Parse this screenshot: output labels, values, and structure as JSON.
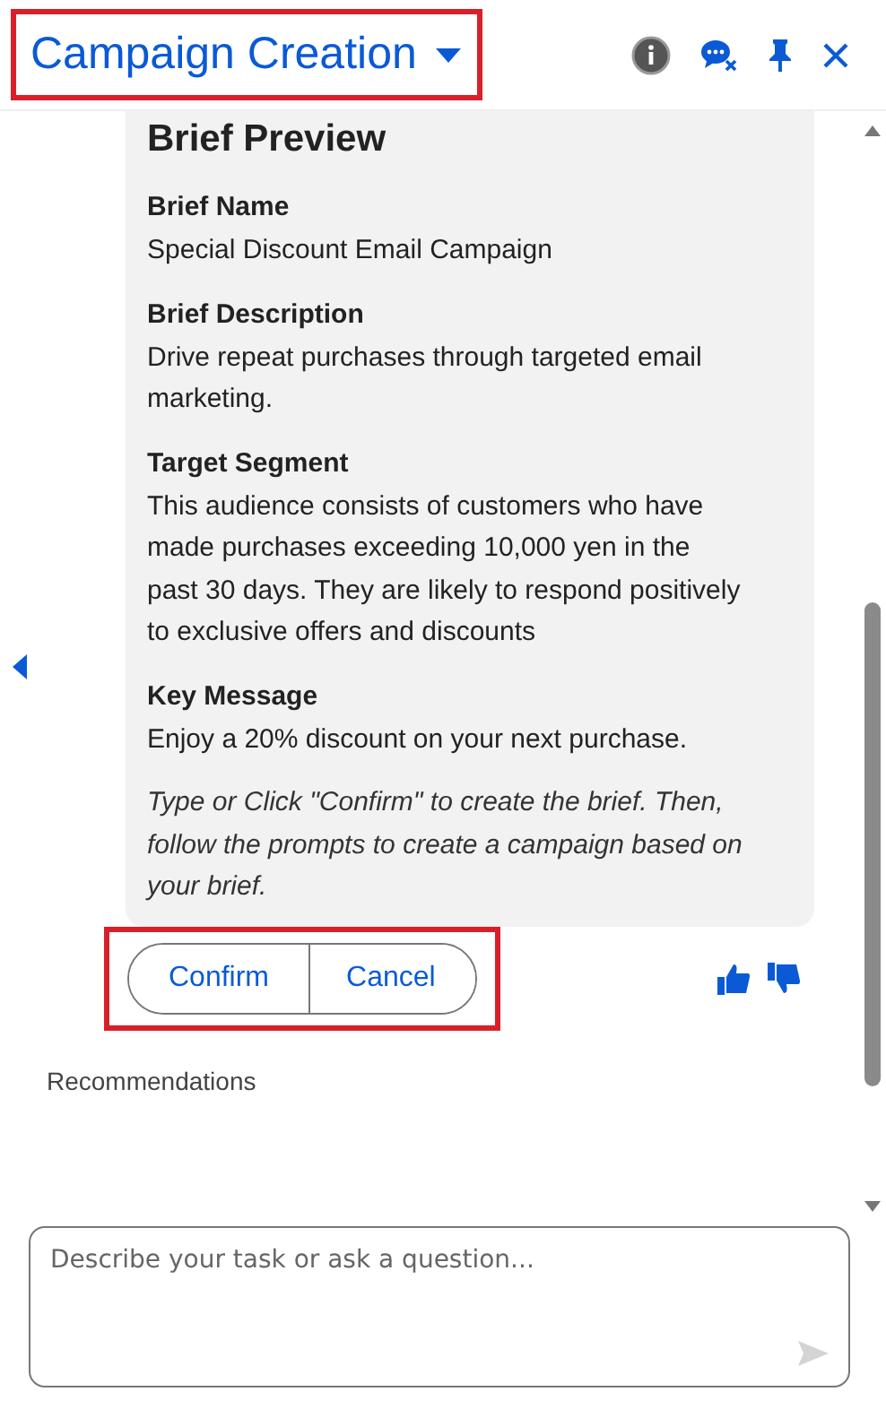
{
  "header": {
    "title": "Campaign Creation",
    "highlighted": true
  },
  "card": {
    "title": "Brief Preview",
    "sections": [
      {
        "label": "Brief Name",
        "value": "Special Discount Email Campaign"
      },
      {
        "label": "Brief Description",
        "value": "Drive repeat purchases through targeted email marketing."
      },
      {
        "label": "Target Segment",
        "value": "This audience consists of customers who have made purchases exceeding 10,000 yen in the past 30 days. They are likely to respond positively to exclusive offers and discounts"
      },
      {
        "label": "Key Message",
        "value": "Enjoy a 20% discount on your next purchase."
      }
    ],
    "note": "Type or Click \"Confirm\" to create the brief. Then, follow the prompts to create a campaign based on your brief."
  },
  "actions": {
    "highlighted": true,
    "buttons": [
      "Confirm",
      "Cancel"
    ]
  },
  "recommendations": "Recommendations",
  "input": {
    "placeholder": "Describe your task or ask a question..."
  }
}
